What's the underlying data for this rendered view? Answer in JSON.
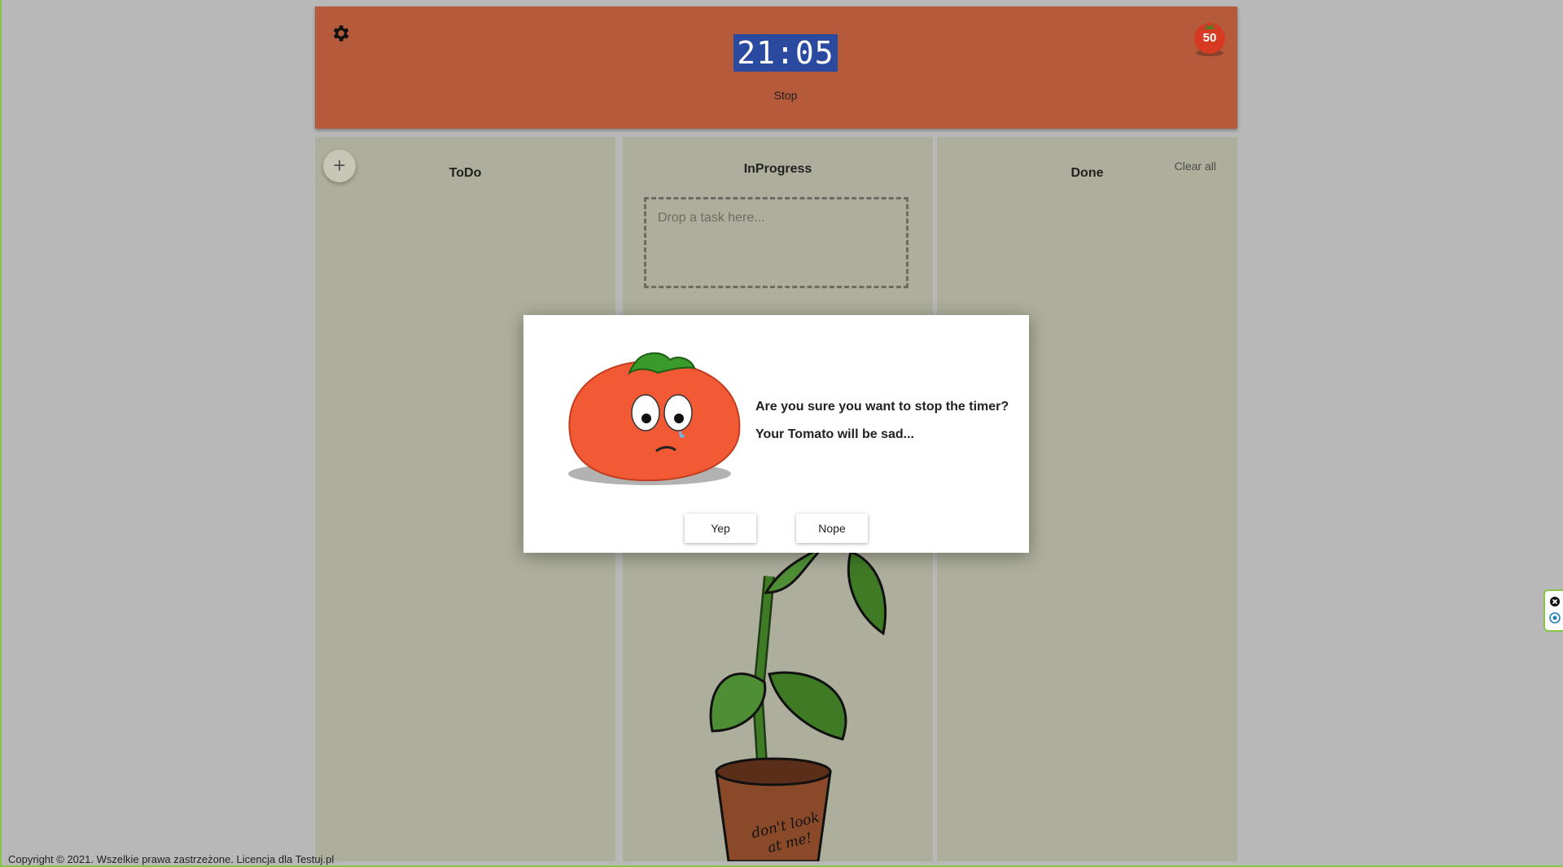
{
  "header": {
    "timer_text": "21:05",
    "stop_label": "Stop",
    "tomato_count": "50"
  },
  "columns": {
    "todo": {
      "title": "ToDo",
      "add_label": "+"
    },
    "inprogress": {
      "title": "InProgress",
      "dropzone_placeholder": "Drop a task here..."
    },
    "done": {
      "title": "Done",
      "clear_label": "Clear all"
    }
  },
  "plant": {
    "pot_text_line1": "don't look",
    "pot_text_line2": "at me!"
  },
  "dialog": {
    "line1": "Are you sure you want to stop the timer?",
    "line2": "Your Tomato will be sad...",
    "yes_label": "Yep",
    "no_label": "Nope"
  },
  "footer": {
    "copyright": "Copyright © 2021. Wszelkie prawa zastrzeżone. Licencja dla Testuj.pl"
  },
  "colors": {
    "header_bg": "#b55a3a",
    "column_bg": "#adae9b",
    "timer_highlight": "#2a4aa0",
    "tomato": "#ff5a3a"
  }
}
